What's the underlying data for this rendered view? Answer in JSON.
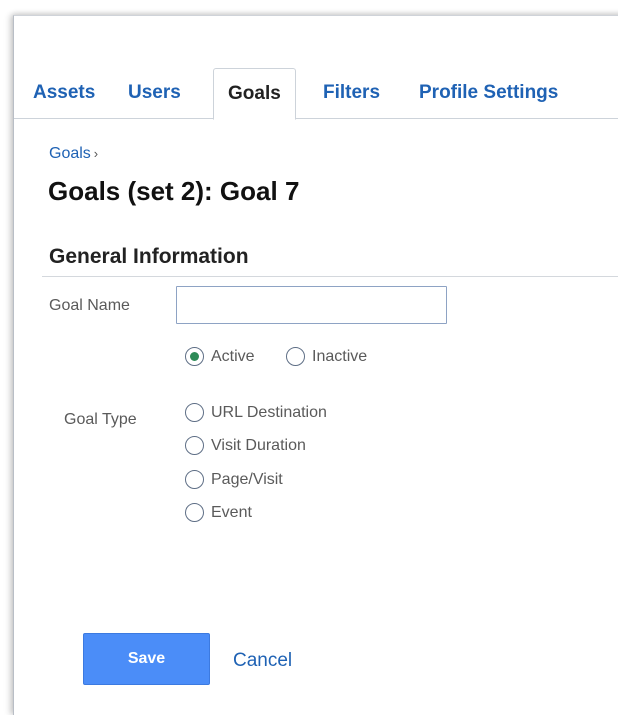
{
  "tabs": [
    {
      "label": "Assets",
      "active": false
    },
    {
      "label": "Users",
      "active": false
    },
    {
      "label": "Goals",
      "active": true
    },
    {
      "label": "Filters",
      "active": false
    },
    {
      "label": "Profile Settings",
      "active": false
    }
  ],
  "breadcrumb": {
    "link": "Goals",
    "separator": "›"
  },
  "page_title": "Goals (set 2): Goal 7",
  "section": {
    "title": "General Information"
  },
  "form": {
    "goal_name": {
      "label": "Goal Name",
      "value": "",
      "placeholder": ""
    },
    "status": {
      "options": [
        {
          "label": "Active",
          "selected": true
        },
        {
          "label": "Inactive",
          "selected": false
        }
      ]
    },
    "goal_type": {
      "label": "Goal Type",
      "options": [
        {
          "label": "URL Destination",
          "selected": false
        },
        {
          "label": "Visit Duration",
          "selected": false
        },
        {
          "label": "Page/Visit",
          "selected": false
        },
        {
          "label": "Event",
          "selected": false
        }
      ]
    }
  },
  "actions": {
    "save_label": "Save",
    "cancel_label": "Cancel"
  },
  "colors": {
    "link": "#1f62b4",
    "save_button": "#4b8df8",
    "radio_selected": "#2e8b57"
  }
}
